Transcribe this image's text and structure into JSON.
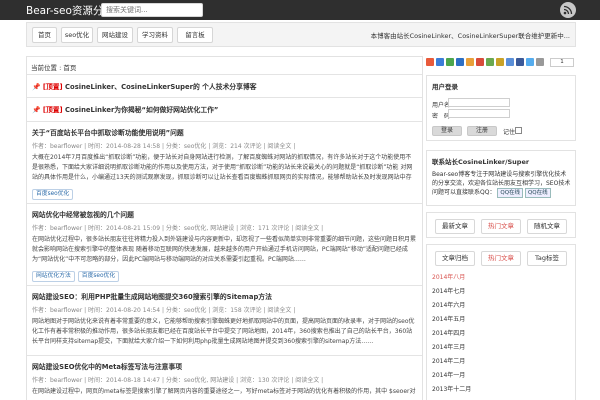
{
  "header": {
    "title": "Bear-seo资源分享",
    "search_placeholder": "搜索关键词..."
  },
  "nav": {
    "items": [
      "首页",
      "seo优化",
      "网站建设",
      "学习资料",
      "留言板"
    ],
    "notice": "本博客由站长CosineLinker、CosineLinkerSuper联合维护更新中..."
  },
  "breadcrumb": "当前位置 : 首页",
  "sticky_posts": [
    {
      "tag": "[顶置]",
      "title": "CosineLinker、CosineLinkerSuper的 个人技术分享博客"
    },
    {
      "tag": "[顶置]",
      "title": "CosineLinker为你揭秘“如何做好网站优化工作”"
    }
  ],
  "posts": [
    {
      "title": "关于“百度站长平台中抓取诊断功能使用说明”问题",
      "meta": "作者：bearflower | 时间：2014-08-28 14:58 | 分类：seo优化 | 浏览：214 次评论 | 阅读全文 |",
      "excerpt": "大概在2014年7月百度推出“抓取诊断”功能，便于站长对自身网站进行检测，了解百度蜘蛛对网站的抓取情况，有许多站长对于这个功能使用不是很熟悉，下面给大家详细说明抓取诊断功能的作用以及使用方法，对于使用“抓取诊断”功能的站长来说最关心的问题就是“抓取诊断”功能 对网站的具体作用是什么，小编通过13天的测试观察发现，抓取诊断可以让站长查看百度蜘蛛抓取网页的实际情况，能够帮助站长及时发现网站中存在的问题以及网页的抓取情况——百度站长平台中抓取诊断功能使用说明……",
      "tags": [
        "百度seo优化"
      ]
    },
    {
      "title": "网站优化中经常被忽视的几个问题",
      "meta": "作者：bearflower | 时间：2014-08-21 15:09 | 分类：seo优化, 网站建设 | 浏览：171 次评论 | 阅读全文 |",
      "excerpt": "在网站优化过程中，很多站长朋友往往将精力投入到外链建设与内容更新中，却忽视了一些看似简单实则非常重要的细节问题，这些问题日积月累就会影响网站在搜索引擎中的整体表现 随着移动互联网的快速发展，越来越多的用户开始通过手机访问网站，PC端网站“移动”适配问题已经成为“网站优化”中不可忽略的部分，因此PC端网站与移动端网站的对应关系需要引起重视。PC端网站……",
      "tags": [
        "网站优化方法",
        "百度seo优化"
      ]
    },
    {
      "title": "网站建设SEO：利用PHP批量生成网站地图提交360搜索引擎的Sitemap方法",
      "meta": "作者：bearflower | 时间：2014-08-20 14:54 | 分类：seo优化 | 浏览：158 次评论 | 阅读全文 |",
      "excerpt": "网站地图对于网站优化来说有着非常重要的意义，它能够帮助搜索引擎蜘蛛更好地抓取网站中的页面，提高网站页面的收录率，对于网站的seo优化工作有着非常积极的推动作用，很多站长朋友都已经在百度站长平台中提交了网站地图，2014年，360搜索也推出了自己的站长平台，360站长平台同样支持sitemap提交，下面就给大家介绍一下如何利用php批量生成网站地图并提交到360搜索引擎的sitemap方法……",
      "tags": []
    },
    {
      "title": "网站建设SEO优化中的Meta标签写法与注意事项",
      "meta": "作者：bearflower | 时间：2014-08-18 14:47 | 分类：seo优化, 网站建设 | 浏览：130 次评论 | 阅读全文 |",
      "excerpt": "在网站建设过程中，网页的meta标签是搜索引擎了解网页内容的重要途径之一，写好meta标签对于网站的优化有着积极的作用，其中 $seoer对网站的标题、关键词、描述……",
      "tags": []
    }
  ],
  "share": {
    "count": "1"
  },
  "login": {
    "heading": "用户登录",
    "username_label": "用户名",
    "password_label": "密　码",
    "captcha_label": "验证码",
    "login_label": "登录",
    "register_label": "注册",
    "remember_label": "记住"
  },
  "contact": {
    "heading": "联系站长CosineLinker/Super",
    "text": "Bear-seo博客专注于网站建设与搜索引擎优化技术的分享交流，欢迎各位站长朋友互相学习，SEO技术问题可以直接联系QQ：",
    "qq1": "QQ在线",
    "qq2": "QQ在线"
  },
  "tabs1": [
    "最新文章",
    "热门文章",
    "随机文章"
  ],
  "tabs2": [
    "文章归档",
    "热门文章",
    "Tag标签"
  ],
  "archive": [
    "2014年八月",
    "2014年七月",
    "2014年六月",
    "2014年五月",
    "2014年四月",
    "2014年三月",
    "2014年二月",
    "2014年一月",
    "2013年十二月"
  ],
  "colors": {
    "topbar": "#2f2f2f",
    "active_tab": "#d9534f",
    "link": "#2a6aa8"
  }
}
